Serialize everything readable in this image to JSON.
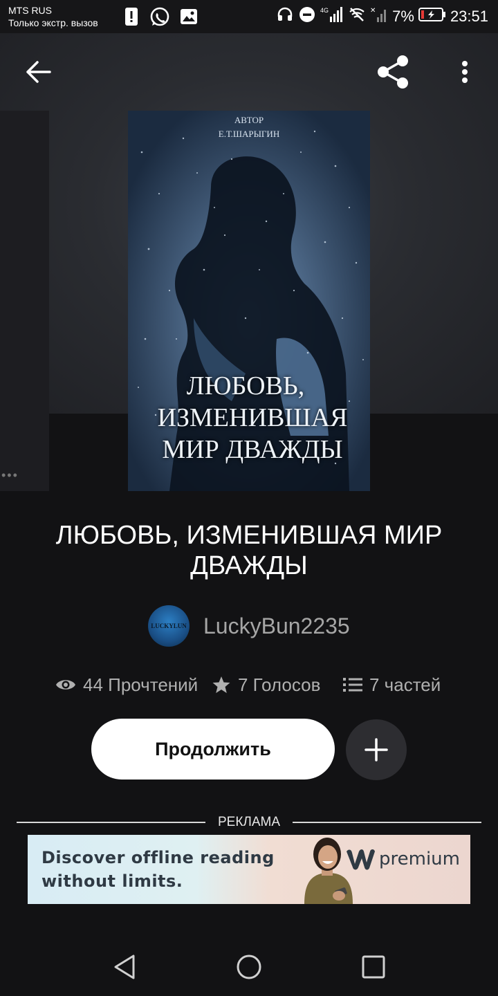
{
  "status_bar": {
    "carrier": "MTS RUS",
    "carrier_sub": "Только экстр. вызов",
    "battery": "7%",
    "time": "23:51",
    "network": "4G"
  },
  "toolbar": {
    "back_icon": "arrow-left-icon",
    "share_icon": "share-icon",
    "more_icon": "more-vertical-icon"
  },
  "cover": {
    "author_label": "АВТОР",
    "author_name": "Е.Т.ШАРЫГИН",
    "title_line1": "ЛЮБОВЬ,",
    "title_line2": "ИЗМЕНИВШАЯ",
    "title_line3": "МИР ДВАЖДЫ"
  },
  "story": {
    "title": "ЛЮБОВЬ, ИЗМЕНИВШАЯ МИР ДВАЖДЫ",
    "author": "LuckyBun2235",
    "avatar_text": "LUCKYLUN",
    "reads": "44 Прочтений",
    "votes": "7 Голосов",
    "parts": "7 частей"
  },
  "actions": {
    "continue_label": "Продолжить",
    "add_icon": "plus-icon"
  },
  "ad": {
    "label": "РЕКЛАМА",
    "line1": "Discover offline reading",
    "line2": "without limits.",
    "brand": "premium"
  },
  "colors": {
    "background": "#121214",
    "button_white": "#ffffff",
    "secondary_text": "#b0b0b0"
  }
}
